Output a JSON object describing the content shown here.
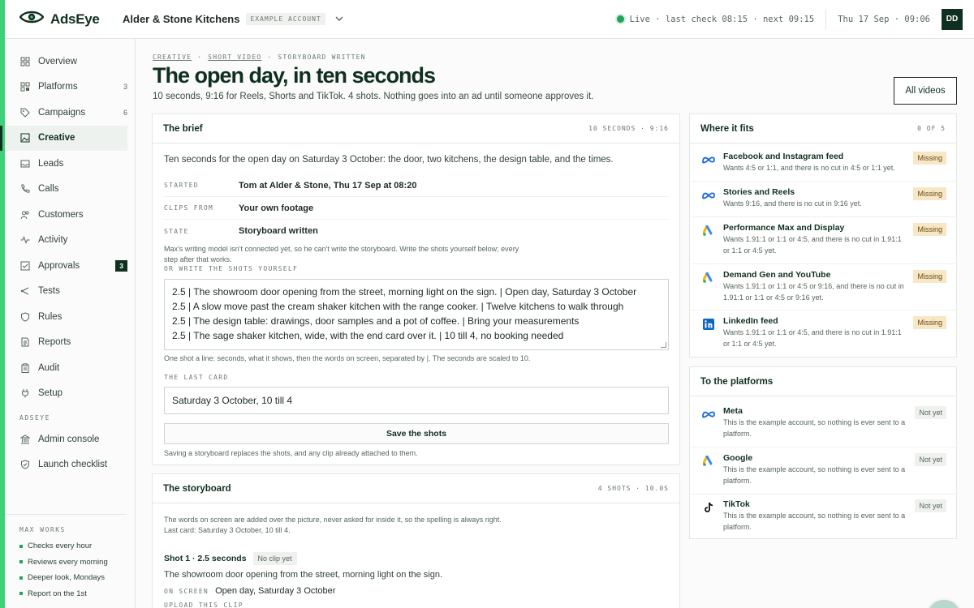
{
  "brand": {
    "name": "AdsEye",
    "accent": "#3fd17a",
    "dark": "#10301f"
  },
  "account": {
    "name": "Alder & Stone Kitchens",
    "badge": "EXAMPLE ACCOUNT"
  },
  "status": {
    "live": "Live · last check 08:15 · next 09:15",
    "clock": "Thu 17 Sep · 09:06",
    "avatar": "DD"
  },
  "sidebar": {
    "items": [
      {
        "label": "Overview",
        "icon": "grid-icon"
      },
      {
        "label": "Platforms",
        "icon": "platforms-icon",
        "count": "3"
      },
      {
        "label": "Campaigns",
        "icon": "tag-icon",
        "count": "6"
      },
      {
        "label": "Creative",
        "icon": "image-icon",
        "active": true
      },
      {
        "label": "Leads",
        "icon": "inbox-icon"
      },
      {
        "label": "Calls",
        "icon": "phone-icon"
      },
      {
        "label": "Customers",
        "icon": "people-icon"
      },
      {
        "label": "Activity",
        "icon": "pulse-icon"
      },
      {
        "label": "Approvals",
        "icon": "check-square-icon",
        "badge": "3"
      },
      {
        "label": "Tests",
        "icon": "branch-icon"
      },
      {
        "label": "Rules",
        "icon": "shield-icon"
      },
      {
        "label": "Reports",
        "icon": "document-icon"
      },
      {
        "label": "Audit",
        "icon": "clipboard-icon"
      },
      {
        "label": "Setup",
        "icon": "plug-icon"
      }
    ],
    "section": "ADSEYE",
    "admin_items": [
      {
        "label": "Admin console",
        "icon": "bank-icon"
      },
      {
        "label": "Launch checklist",
        "icon": "shield-check-icon"
      }
    ],
    "max_works": {
      "heading": "MAX WORKS",
      "items": [
        "Checks every hour",
        "Reviews every morning",
        "Deeper look, Mondays",
        "Report on the 1st"
      ]
    }
  },
  "page": {
    "crumbs": [
      "CREATIVE",
      "SHORT VIDEO",
      "STORYBOARD WRITTEN"
    ],
    "title": "The open day, in ten seconds",
    "subtitle": "10 seconds, 9:16 for Reels, Shorts and TikTok. 4 shots. Nothing goes into an ad until someone approves it.",
    "all_videos": "All videos"
  },
  "brief": {
    "title": "The brief",
    "meta": "10 SECONDS · 9:16",
    "intro": "Ten seconds for the open day on Saturday 3 October: the door, two kitchens, the design table, and the times.",
    "fields": [
      {
        "k": "STARTED",
        "v": "Tom at Alder & Stone, Thu 17 Sep at 08:20"
      },
      {
        "k": "CLIPS FROM",
        "v": "Your own footage"
      },
      {
        "k": "STATE",
        "v": "Storyboard written"
      }
    ],
    "note": "Max's writing model isn't connected yet, so he can't write the storyboard. Write the shots yourself below; every step after that works.",
    "write_label": "OR WRITE THE SHOTS YOURSELF",
    "shots_text": [
      "2.5 | The showroom door opening from the street, morning light on the sign. | Open day, Saturday 3 October",
      "2.5 | A slow move past the cream shaker kitchen with the range cooker. | Twelve kitchens to walk through",
      "2.5 | The design table: drawings, door samples and a pot of coffee. | Bring your measurements",
      "2.5 | The sage shaker kitchen, wide, with the end card over it. | 10 till 4, no booking needed"
    ],
    "shots_hint": "One shot a line: seconds, what it shows, then the words on screen, separated by |. The seconds are scaled to 10.",
    "last_card_label": "THE LAST CARD",
    "last_card_value": "Saturday 3 October, 10 till 4",
    "save_label": "Save the shots",
    "save_hint": "Saving a storyboard replaces the shots, and any clip already attached to them."
  },
  "storyboard": {
    "title": "The storyboard",
    "meta": "4 SHOTS · 10.0S",
    "note": "The words on screen are added over the picture, never asked for inside it, so the spelling is always right. Last card: Saturday 3 October, 10 till 4.",
    "shot1": {
      "title": "Shot 1 · 2.5 seconds",
      "status": "No clip yet",
      "desc": "The showroom door opening from the street, morning light on the sign.",
      "onscreen_label": "ON SCREEN",
      "onscreen": "Open day, Saturday 3 October",
      "upload_label": "UPLOAD THIS CLIP"
    }
  },
  "fits": {
    "title": "Where it fits",
    "meta": "0 OF 5",
    "rows": [
      {
        "name": "Facebook and Instagram feed",
        "desc": "Wants 4:5 or 1:1, and there is no cut in 4:5 or 1:1 yet.",
        "status": "Missing",
        "icon": "meta-icon"
      },
      {
        "name": "Stories and Reels",
        "desc": "Wants 9:16, and there is no cut in 9:16 yet.",
        "status": "Missing",
        "icon": "meta-icon"
      },
      {
        "name": "Performance Max and Display",
        "desc": "Wants 1.91:1 or 1:1 or 4:5, and there is no cut in 1.91:1 or 1:1 or 4:5 yet.",
        "status": "Missing",
        "icon": "google-ads-icon"
      },
      {
        "name": "Demand Gen and YouTube",
        "desc": "Wants 1.91:1 or 1:1 or 4:5 or 9:16, and there is no cut in 1.91:1 or 1:1 or 4:5 or 9:16 yet.",
        "status": "Missing",
        "icon": "google-ads-icon"
      },
      {
        "name": "LinkedIn feed",
        "desc": "Wants 1.91:1 or 1:1 or 4:5, and there is no cut in 1.91:1 or 1:1 or 4:5 yet.",
        "status": "Missing",
        "icon": "linkedin-icon"
      }
    ]
  },
  "to_platforms": {
    "title": "To the platforms",
    "rows": [
      {
        "name": "Meta",
        "desc": "This is the example account, so nothing is ever sent to a platform.",
        "status": "Not yet",
        "icon": "meta-icon"
      },
      {
        "name": "Google",
        "desc": "This is the example account, so nothing is ever sent to a platform.",
        "status": "Not yet",
        "icon": "google-ads-icon"
      },
      {
        "name": "TikTok",
        "desc": "This is the example account, so nothing is ever sent to a platform.",
        "status": "Not yet",
        "icon": "tiktok-icon"
      }
    ]
  },
  "helper": {
    "icon": "assistant-avatar-icon"
  }
}
